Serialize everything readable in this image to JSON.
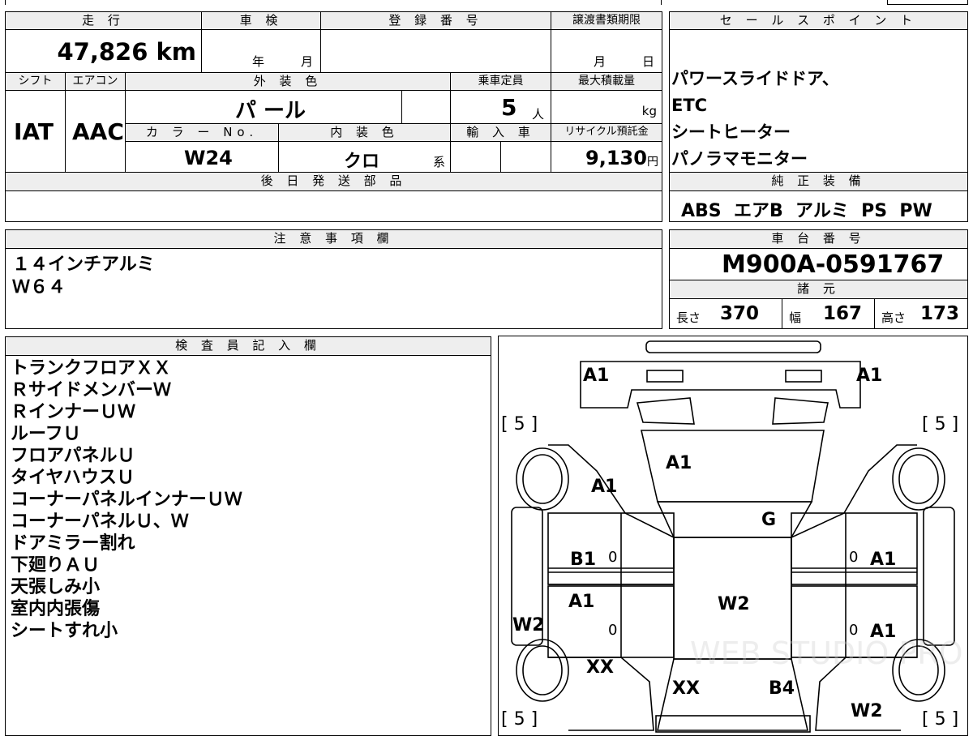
{
  "top_table": {
    "mileage_header": "走 行",
    "mileage": "47,826 km",
    "shaken_header": "車 検",
    "shaken_year_unit": "年",
    "shaken_month_unit": "月",
    "registration_header": "登 録 番 号",
    "transfer_header": "譲渡書類期限",
    "transfer_month_unit": "月",
    "transfer_day_unit": "日",
    "shift_header": "シフト",
    "shift": "IAT",
    "aircon_header": "エアコン",
    "aircon": "AAC",
    "exterior_color_header": "外 装 色",
    "exterior_color": "パ ール",
    "capacity_header": "乗車定員",
    "capacity": "5",
    "capacity_unit": "人",
    "max_load_header": "最大積載量",
    "max_load_unit": "kg",
    "color_no_header": "カ ラ ー No.",
    "color_no": "W24",
    "interior_color_header": "内 装 色",
    "interior_color": "クロ",
    "interior_color_suffix": "系",
    "import_header": "輸 入 車",
    "recycle_header": "リサイクル預託金",
    "recycle_fee": "9,130",
    "recycle_unit": "円",
    "later_parts_header": "後 日 発 送 部 品"
  },
  "sales_points": {
    "header": "セ ー ル ス ポ イ ン ト",
    "items": [
      "パワースライドドア、",
      "ETC",
      "シートヒーター",
      "パノラマモニター"
    ]
  },
  "standard_equipment": {
    "header": "純 正 装 備",
    "items": "ABS  エアB  アルミ  PS  PW"
  },
  "notes": {
    "header": "注 意 事 項 欄",
    "lines": [
      "１４インチアルミ",
      "Ｗ６４"
    ]
  },
  "chassis": {
    "header": "車 台 番 号",
    "number": "M900A-0591767"
  },
  "specs": {
    "header": "諸 元",
    "length_label": "長さ",
    "length": "370",
    "width_label": "幅",
    "width": "167",
    "height_label": "高さ",
    "height": "173"
  },
  "inspector": {
    "header": "検 査 員 記 入 欄",
    "lines": [
      "トランクフロアＸＸ",
      "ＲサイドメンバーＷ",
      "ＲインナーＵＷ",
      "ルーフＵ",
      "フロアパネルＵ",
      "タイヤハウスＵ",
      "コーナーパネルインナーＵＷ",
      "コーナーパネルＵ、Ｗ",
      "ドアミラー割れ",
      "下廻りＡＵ",
      "天張しみ小",
      "室内内張傷",
      "シートすれ小"
    ]
  },
  "diagram": {
    "tire_marks": [
      "[ 5 ]",
      "[ 5 ]",
      "[ 5 ]",
      "[ 5 ]"
    ],
    "labels": {
      "front_left": "A1",
      "front_right": "A1",
      "hood": "A1",
      "left_fender": "A1",
      "windshield": "G",
      "left_front_door": "B1",
      "left_rear_door": "A1",
      "right_front_door": "A1",
      "right_rear_door": "A1",
      "roof": "W2",
      "left_rocker": "W2",
      "left_quarter": "XX",
      "rear_glass": "XX",
      "rear_right": "B4",
      "right_quarter": "W2",
      "zero_1": "0",
      "zero_2": "0",
      "zero_3": "0",
      "zero_4": "0"
    },
    "watermark": "WEB STUDIO PRO"
  }
}
